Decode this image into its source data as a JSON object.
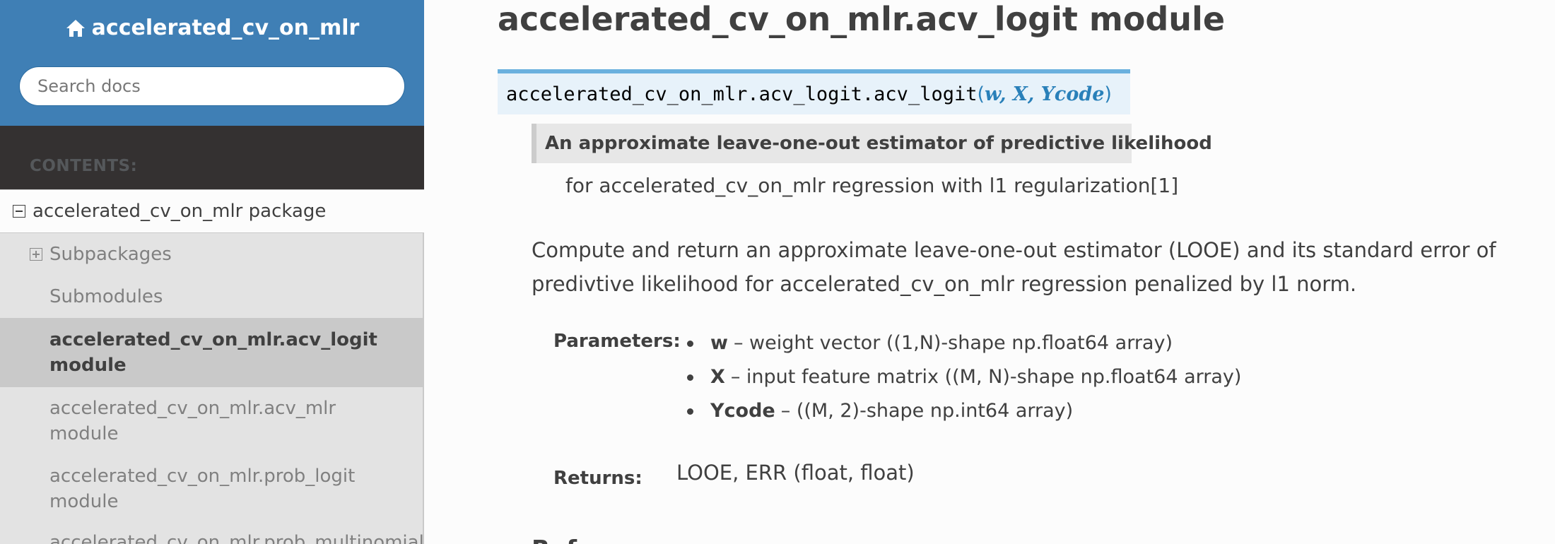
{
  "sidebar": {
    "project_title": "accelerated_cv_on_mlr",
    "search": {
      "placeholder": "Search docs",
      "value": ""
    },
    "contents_caption": "CONTENTS:",
    "nav": {
      "package": "accelerated_cv_on_mlr package",
      "subpackages": "Subpackages",
      "submodules": "Submodules",
      "modules": [
        "accelerated_cv_on_mlr.acv_logit module",
        "accelerated_cv_on_mlr.acv_mlr module",
        "accelerated_cv_on_mlr.prob_logit module",
        "accelerated_cv_on_mlr.prob_multinomial"
      ]
    }
  },
  "main": {
    "page_title": "accelerated_cv_on_mlr.acv_logit module",
    "signature": {
      "name": "accelerated_cv_on_mlr.acv_logit.acv_logit",
      "open_paren": "(",
      "params": "w, X, Ycode",
      "close_paren": ")"
    },
    "summary": "An approximate leave-one-out estimator of predictive likelihood",
    "summary_continuation": "for accelerated_cv_on_mlr regression with l1 regularization[1]",
    "description": "Compute and return an approximate leave-one-out estimator (LOOE) and its standard error of predivtive likelihood for accelerated_cv_on_mlr regression penalized by l1 norm.",
    "parameters_label": "Parameters:",
    "parameters": [
      {
        "name": "w",
        "desc": "– weight vector ((1,N)-shape np.float64 array)"
      },
      {
        "name": "X",
        "desc": "– input feature matrix ((M, N)-shape np.float64 array)"
      },
      {
        "name": "Ycode",
        "desc": "– ((M, 2)-shape np.int64 array)"
      }
    ],
    "returns_label": "Returns:",
    "returns_value": "LOOE, ERR (float, float)",
    "next_heading": "References"
  },
  "colors": {
    "sidebar_header": "#3f7fb5",
    "sidebar_dark_band": "#343131",
    "sidebar_bg": "#e3e3e3",
    "signature_bg": "#e7f2fa",
    "signature_accent": "#6ab0de",
    "link_blue": "#2980b9",
    "text": "#404040"
  },
  "icons": {
    "home": "home-icon",
    "collapse": "minus-square-icon",
    "expand": "plus-square-icon"
  }
}
